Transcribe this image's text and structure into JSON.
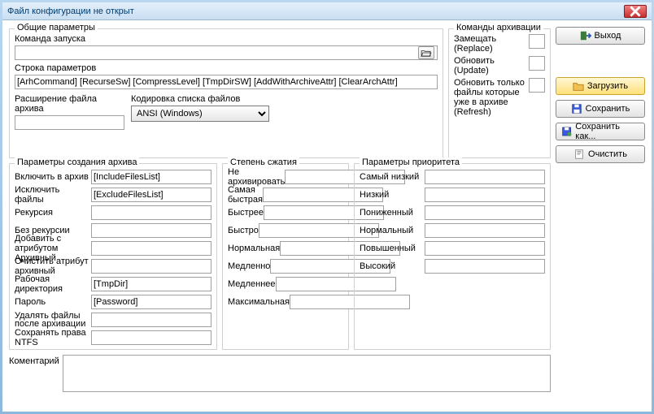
{
  "window": {
    "title": "Файл конфигурации не открыт"
  },
  "general": {
    "legend": "Общие параметры",
    "launch_cmd_label": "Команда запуска",
    "launch_cmd_value": "",
    "params_label": "Строка параметров",
    "params_value": "[ArhCommand] [RecurseSw] [CompressLevel] [TmpDirSW] [AddWithArchiveAttr] [ClearArchAttr]",
    "ext_label": "Расширение файла архива",
    "ext_value": "",
    "encoding_label": "Кодировка списка файлов",
    "encoding_value": "ANSI (Windows)"
  },
  "archive_cmds": {
    "legend": "Команды архивации",
    "rows": [
      {
        "label": "Замещать (Replace)",
        "value": ""
      },
      {
        "label": "Обновить (Update)",
        "value": ""
      },
      {
        "label": "Обновить только файлы которые уже в архиве (Refresh)",
        "value": ""
      }
    ]
  },
  "create_params": {
    "legend": "Параметры создания архива",
    "rows": [
      {
        "label": "Включить в архив",
        "value": "[IncludeFilesList]"
      },
      {
        "label": "Исключить файлы",
        "value": "[ExcludeFilesList]"
      },
      {
        "label": "Рекурсия",
        "value": ""
      },
      {
        "label": "Без рекурсии",
        "value": ""
      },
      {
        "label": "Добавить с атрибутом Архивный",
        "value": ""
      },
      {
        "label": "Очистить атрибут архивный",
        "value": ""
      },
      {
        "label": "Рабочая директория",
        "value": "[TmpDir]"
      },
      {
        "label": "Пароль",
        "value": "[Password]"
      },
      {
        "label": "Удалять файлы после архивации",
        "value": ""
      },
      {
        "label": "Сохранять права NTFS",
        "value": ""
      }
    ]
  },
  "compression": {
    "legend": "Степень сжатия",
    "rows": [
      {
        "label": "Не архивировать",
        "value": ""
      },
      {
        "label": "Самая быстрая",
        "value": ""
      },
      {
        "label": "Быстрее",
        "value": ""
      },
      {
        "label": "Быстро",
        "value": ""
      },
      {
        "label": "Нормальная",
        "value": ""
      },
      {
        "label": "Медленно",
        "value": ""
      },
      {
        "label": "Медленнее",
        "value": ""
      },
      {
        "label": "Максимальная",
        "value": ""
      }
    ]
  },
  "priority": {
    "legend": "Параметры приоритета",
    "rows": [
      {
        "label": "Самый низкий",
        "value": ""
      },
      {
        "label": "Низкий",
        "value": ""
      },
      {
        "label": "Пониженный",
        "value": ""
      },
      {
        "label": "Нормальный",
        "value": ""
      },
      {
        "label": "Повышенный",
        "value": ""
      },
      {
        "label": "Высокий",
        "value": ""
      }
    ]
  },
  "comment": {
    "label": "Коментарий",
    "value": ""
  },
  "buttons": {
    "exit": "Выход",
    "load": "Загрузить",
    "save": "Сохранить",
    "save_as": "Сохранить как...",
    "clear": "Очистить"
  }
}
